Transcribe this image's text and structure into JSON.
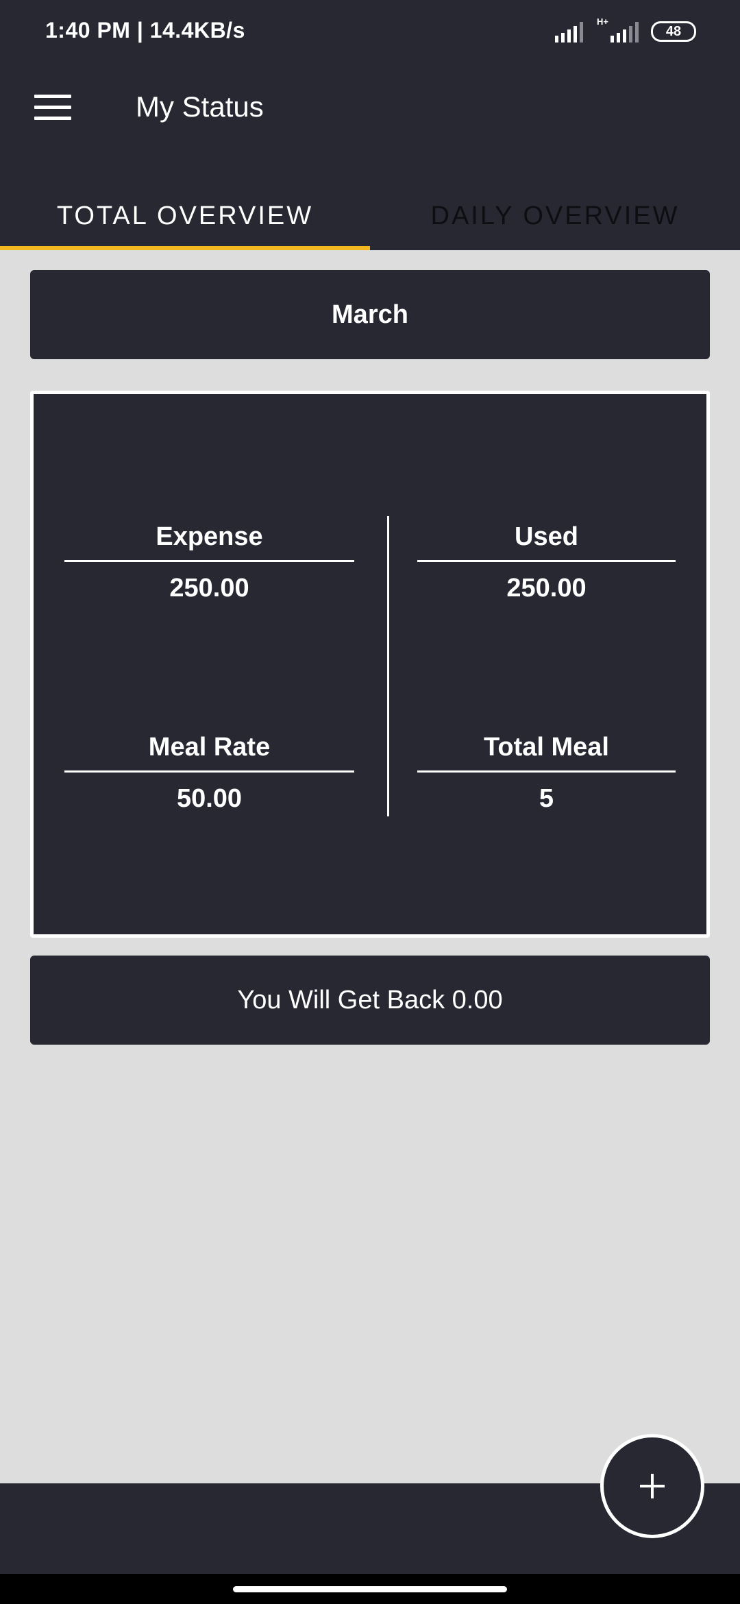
{
  "status_bar": {
    "time": "1:40 PM | 14.4KB/s",
    "network_label": "H+",
    "battery": "48",
    "icons": [
      "signal-icon",
      "signal-icon-2",
      "battery-icon"
    ]
  },
  "header": {
    "title": "My Status",
    "menu_icon": "menu-icon"
  },
  "tabs": [
    {
      "label": "TOTAL OVERVIEW",
      "active": true
    },
    {
      "label": "DAILY OVERVIEW",
      "active": false
    }
  ],
  "month": {
    "label": "March"
  },
  "stats": {
    "expense": {
      "label": "Expense",
      "value": "250.00"
    },
    "used": {
      "label": "Used",
      "value": "250.00"
    },
    "meal_rate": {
      "label": "Meal Rate",
      "value": "50.00"
    },
    "total_meal": {
      "label": "Total Meal",
      "value": "5"
    }
  },
  "summary": {
    "text": "You Will Get Back 0.00"
  },
  "fab": {
    "icon": "plus-icon"
  },
  "colors": {
    "primary_dark": "#282833",
    "accent": "#f3b71f",
    "background": "#dddddd"
  }
}
